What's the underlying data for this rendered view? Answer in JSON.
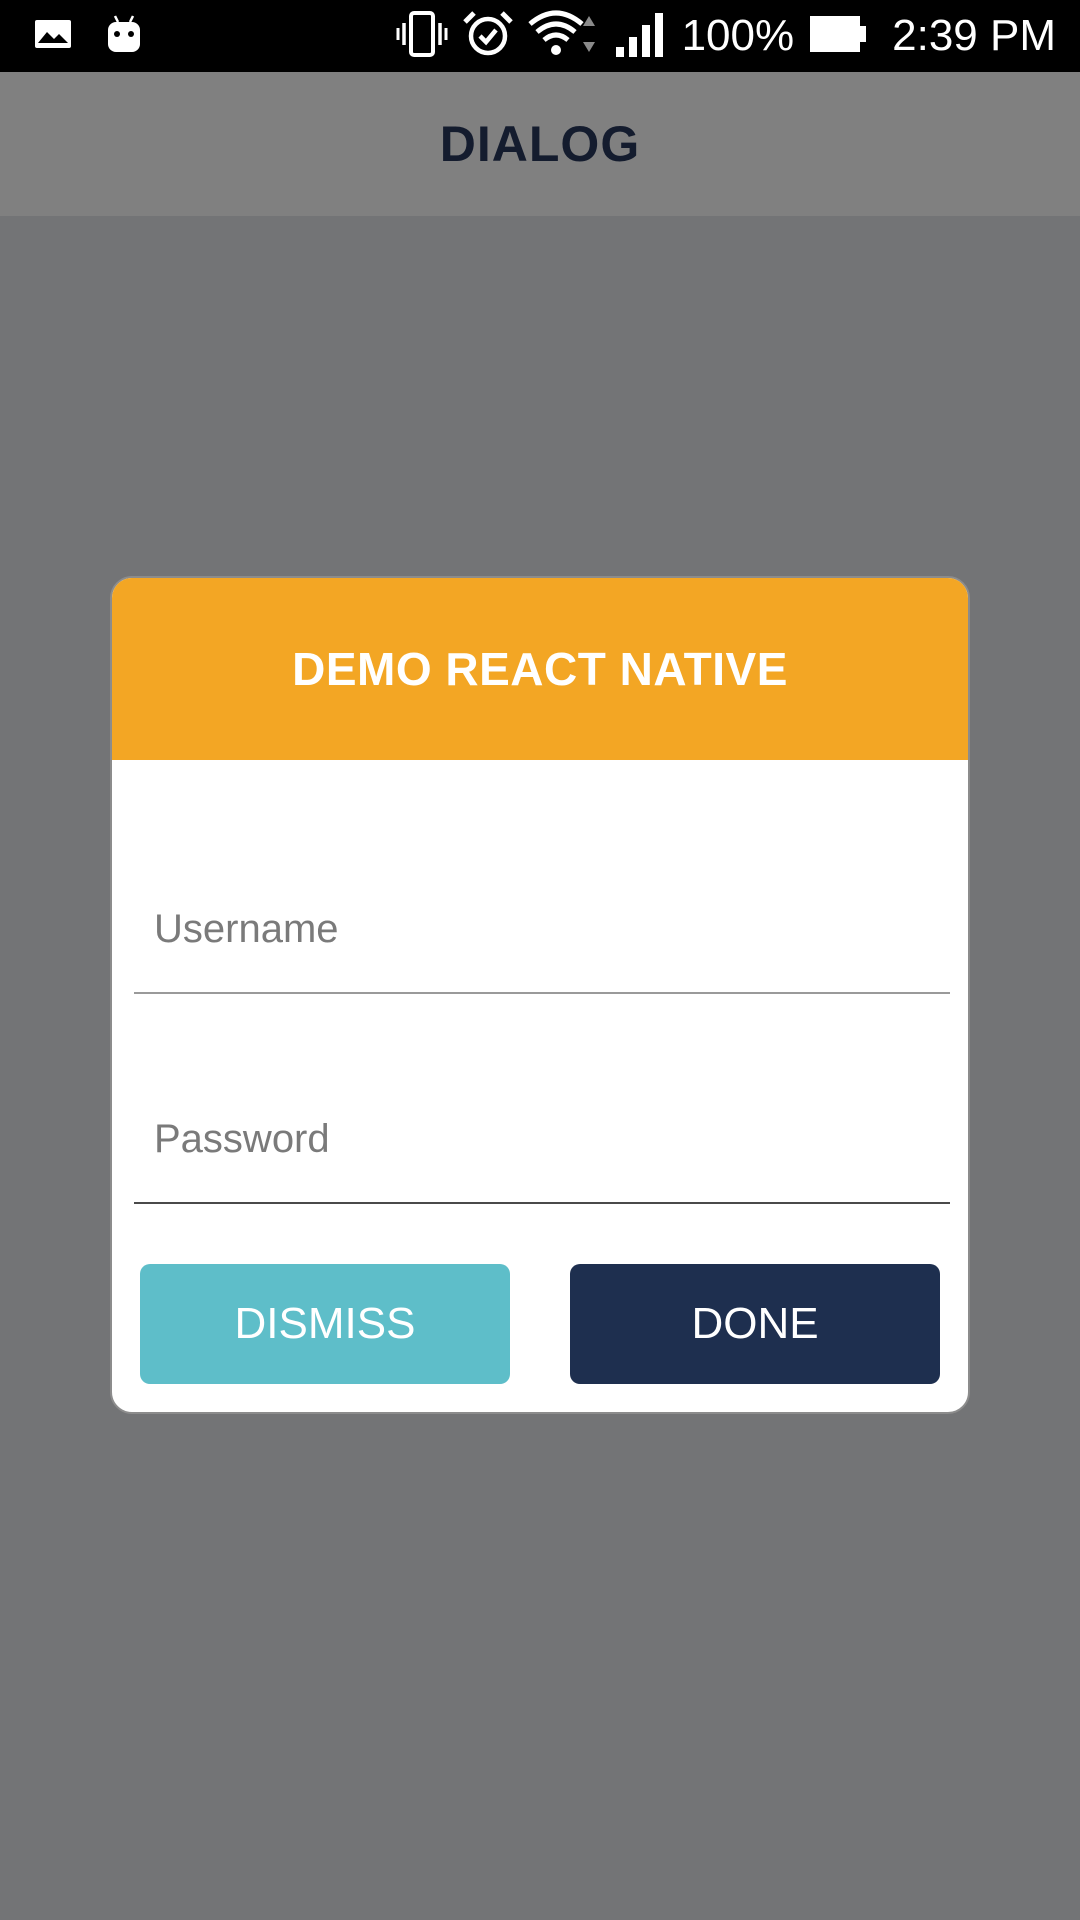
{
  "status_bar": {
    "icons": [
      "gallery-icon",
      "android-icon",
      "vibrate-icon",
      "alarm-icon",
      "wifi-icon",
      "signal-icon",
      "battery-icon"
    ],
    "battery_percent": "100%",
    "time": "2:39 PM"
  },
  "app_bar": {
    "title": "DIALOG"
  },
  "dialog": {
    "title": "DEMO REACT NATIVE",
    "username_placeholder": "Username",
    "password_placeholder": "Password",
    "dismiss_label": "DISMISS",
    "done_label": "DONE"
  },
  "colors": {
    "status_bar": "#000000",
    "app_bar": "#808080",
    "backdrop": "#737476",
    "dialog_header": "#f3a624",
    "dismiss_button": "#5ebec9",
    "done_button": "#1e2f4f",
    "app_title": "#141c2e"
  }
}
